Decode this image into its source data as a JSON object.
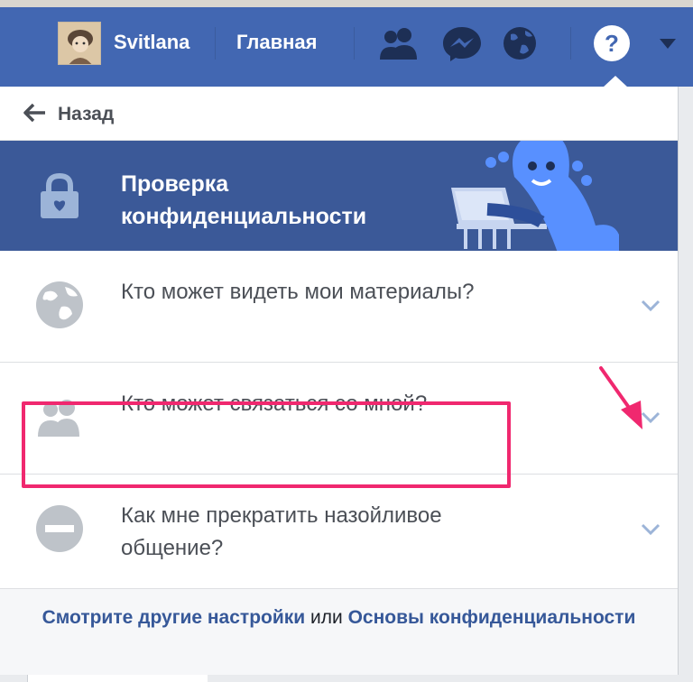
{
  "header": {
    "username": "Svitlana",
    "home_label": "Главная",
    "help_symbol": "?",
    "icons": [
      "friend-requests-icon",
      "messenger-icon",
      "notifications-globe-icon"
    ],
    "bar_color": "#4267b2"
  },
  "panel": {
    "back_label": "Назад",
    "hero": {
      "title": "Проверка конфиденциальности",
      "background": "#3b5998",
      "illustration_accent": "#5890ff"
    },
    "items": [
      {
        "icon": "globe-icon",
        "label": "Кто может видеть мои материалы?"
      },
      {
        "icon": "people-icon",
        "label": "Кто может связаться со мной?"
      },
      {
        "icon": "block-icon",
        "label": "Как мне прекратить назойливое общение?",
        "highlighted": true
      }
    ],
    "footer": {
      "link1": "Смотрите другие настройки",
      "separator": "или",
      "link2": "Основы конфиденциальности"
    },
    "highlight_color": "#f0286f"
  }
}
